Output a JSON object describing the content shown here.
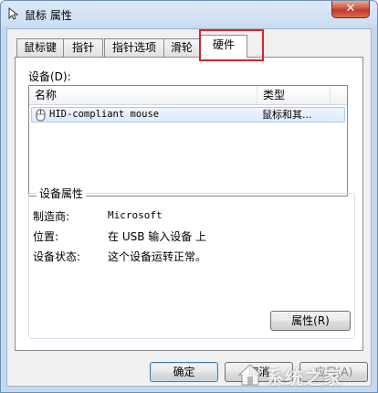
{
  "window": {
    "title": "鼠标 属性",
    "close_glyph": "✕"
  },
  "tabs": [
    {
      "label": "鼠标键",
      "active": false
    },
    {
      "label": "指针",
      "active": false
    },
    {
      "label": "指针选项",
      "active": false
    },
    {
      "label": "滑轮",
      "active": false
    },
    {
      "label": "硬件",
      "active": true
    }
  ],
  "hardware": {
    "devices_label": "设备(D):",
    "columns": [
      "名称",
      "类型"
    ],
    "rows": [
      {
        "name": "HID-compliant mouse",
        "type": "鼠标和其...",
        "icon": "mouse-icon"
      }
    ],
    "properties_group": {
      "title": "设备属性",
      "items": [
        {
          "label": "制造商:",
          "value": "Microsoft"
        },
        {
          "label": "位置:",
          "value": "在 USB 输入设备 上"
        },
        {
          "label": "设备状态:",
          "value": "这个设备运转正常。"
        }
      ],
      "properties_button": "属性(R)"
    }
  },
  "footer": {
    "ok": "确定",
    "cancel": "取消",
    "apply": "应用(A)"
  },
  "watermark": {
    "text": "系统之家"
  },
  "colors": {
    "highlight_box": "#e02020",
    "selection": "#dcebfc",
    "titlebar": "#cfe0f3",
    "close_button": "#c0392b"
  }
}
